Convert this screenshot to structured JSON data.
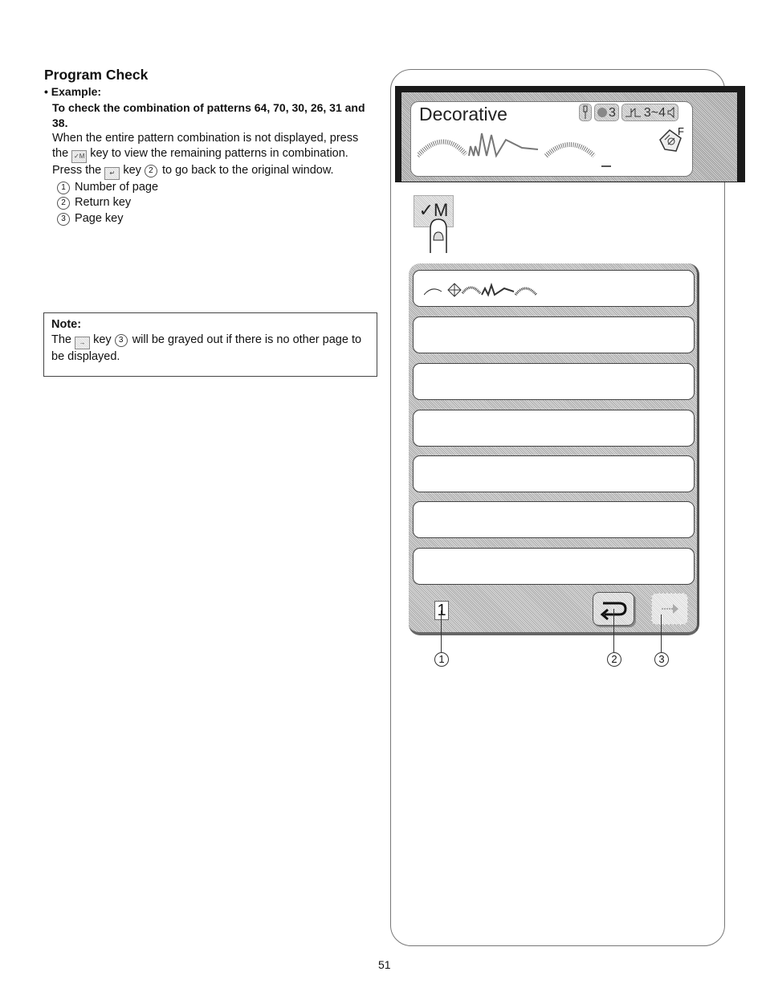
{
  "section": {
    "title": "Program Check",
    "example_label": "• Example:",
    "example_heading": "To check the combination of patterns 64, 70, 30, 26, 31 and 38.",
    "para1_a": "When the entire pattern combination is not displayed, press the",
    "para1_key": "✓M",
    "para1_b": "key to view the remaining patterns in combination.",
    "para2_a": "Press the",
    "para2_key": "↵",
    "para2_b": "key",
    "para2_ref": "2",
    "para2_c": "to go back to the original window.",
    "legend": [
      {
        "num": "1",
        "label": "Number of page"
      },
      {
        "num": "2",
        "label": "Return key"
      },
      {
        "num": "3",
        "label": "Page key"
      }
    ]
  },
  "note": {
    "title": "Note:",
    "text_a": "The",
    "key": "→",
    "text_b": "key",
    "ref": "3",
    "text_c": "will be grayed out if there is no other page to be displayed."
  },
  "screen": {
    "mode_title": "Decorative",
    "status": {
      "needle_icon": "needle-icon",
      "tension_value": "3",
      "length_value": "3~4",
      "sound_icon": "speaker-icon"
    },
    "presser_foot": "F",
    "mk_button_label": "✓M",
    "list_rows": [
      {
        "has_patterns": true
      },
      {
        "has_patterns": false
      },
      {
        "has_patterns": false
      },
      {
        "has_patterns": false
      },
      {
        "has_patterns": false
      },
      {
        "has_patterns": false
      },
      {
        "has_patterns": false
      }
    ],
    "page_number": "1",
    "callouts": [
      "1",
      "2",
      "3"
    ]
  },
  "footer": {
    "page_number": "51"
  }
}
